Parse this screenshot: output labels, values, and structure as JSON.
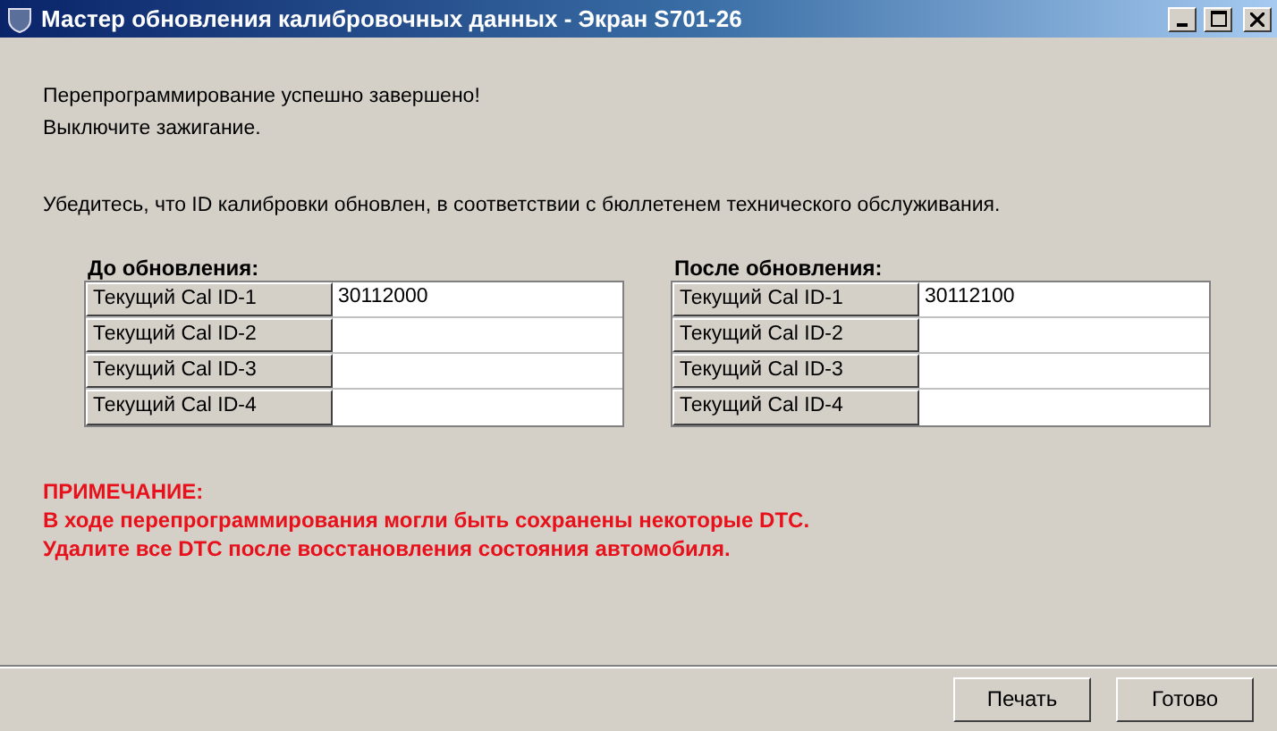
{
  "window": {
    "title": "Мастер обновления калибровочных данных - Экран S701-26"
  },
  "messages": [
    "Перепрограммирование успешно завершено!",
    "Выключите зажигание."
  ],
  "instruction": "Убедитесь, что ID калибровки обновлен, в соответствии с бюллетенем технического обслуживания.",
  "tables": [
    {
      "title": "До обновления:",
      "rows": [
        {
          "label": "Текущий Cal ID-1",
          "value": "30112000"
        },
        {
          "label": "Текущий Cal ID-2"
        },
        {
          "label": "Текущий Cal ID-3"
        },
        {
          "label": "Текущий Cal ID-4"
        }
      ]
    },
    {
      "title": "После обновления:",
      "rows": [
        {
          "label": "Текущий Cal ID-1",
          "value": "30112100"
        },
        {
          "label": "Текущий Cal ID-2"
        },
        {
          "label": "Текущий Cal ID-3"
        },
        {
          "label": "Текущий Cal ID-4"
        }
      ]
    }
  ],
  "note": {
    "title": "ПРИМЕЧАНИЕ:",
    "lines": [
      "В ходе перепрограммирования могли быть сохранены некоторые DTC.",
      "Удалите все DTC после восстановления состояния автомобиля."
    ]
  },
  "buttons": [
    "Печать",
    "Готово"
  ]
}
